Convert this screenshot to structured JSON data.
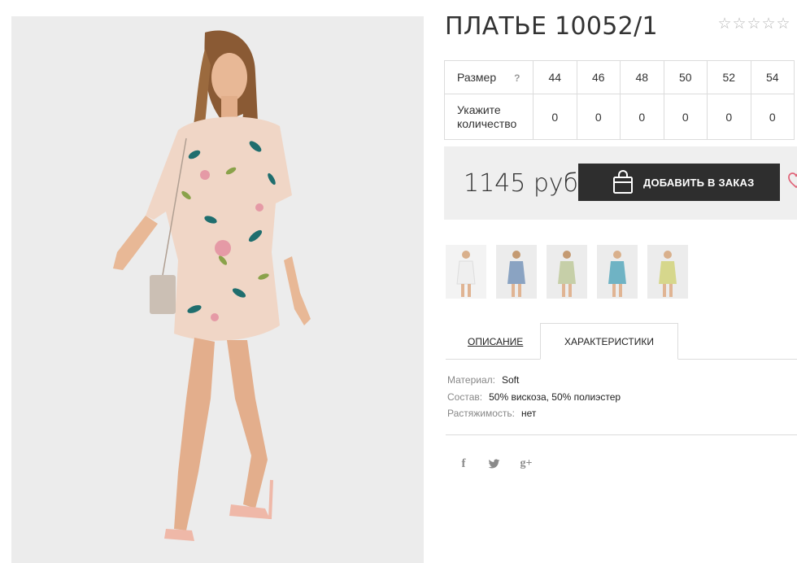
{
  "product": {
    "title": "ПЛАТЬЕ 10052/1",
    "rating_stars": [
      "☆",
      "☆",
      "☆",
      "☆",
      "☆"
    ]
  },
  "size_table": {
    "size_label": "Размер",
    "help": "?",
    "sizes": [
      "44",
      "46",
      "48",
      "50",
      "52",
      "54"
    ],
    "qty_label_line1": "Укажите",
    "qty_label_line2": "количество",
    "quantities": [
      "0",
      "0",
      "0",
      "0",
      "0",
      "0"
    ]
  },
  "purchase": {
    "price": "1145 руб",
    "add_button_label": "ДОБАВИТЬ В ЗАКАЗ",
    "accent_color": "#2e2e2e",
    "heart_color": "#e0667a"
  },
  "thumbnails": [
    {
      "icon": "dress-thumbnail",
      "dress_color": "#efefef"
    },
    {
      "icon": "dress-thumbnail",
      "dress_color": "#8aa3c2"
    },
    {
      "icon": "dress-thumbnail",
      "dress_color": "#c6cfa8"
    },
    {
      "icon": "dress-thumbnail",
      "dress_color": "#6fb3c4"
    },
    {
      "icon": "dress-thumbnail",
      "dress_color": "#d6d78c"
    }
  ],
  "tabs": {
    "description": "ОПИСАНИЕ",
    "characteristics": "ХАРАКТЕРИСТИКИ",
    "active": "characteristics"
  },
  "specs": [
    {
      "key": "Материал:",
      "value": "Soft"
    },
    {
      "key": "Состав:",
      "value": "50% вискоза, 50% полиэстер"
    },
    {
      "key": "Растяжимость:",
      "value": "нет"
    }
  ],
  "social": {
    "facebook": "f",
    "twitter": "twitter-icon",
    "googleplus": "g+"
  }
}
